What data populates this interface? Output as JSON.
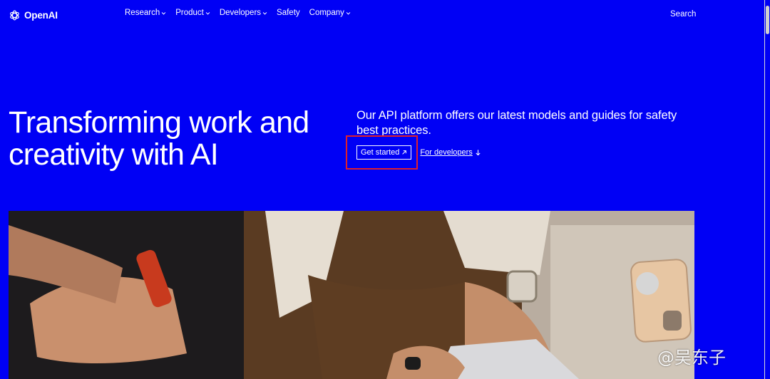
{
  "header": {
    "brand": "OpenAI",
    "nav": [
      {
        "label": "Research",
        "has_menu": true
      },
      {
        "label": "Product",
        "has_menu": true
      },
      {
        "label": "Developers",
        "has_menu": true
      },
      {
        "label": "Safety",
        "has_menu": false
      },
      {
        "label": "Company",
        "has_menu": true
      }
    ],
    "search_label": "Search"
  },
  "hero": {
    "headline_line1": "Transforming work and",
    "headline_line2": "creativity with AI",
    "subtext": "Our API platform offers our latest models and guides for safety best practices.",
    "primary_cta": "Get started",
    "primary_cta_icon": "arrow-up-right-icon",
    "secondary_cta": "For developers",
    "secondary_cta_icon": "arrow-down-icon"
  },
  "watermark": "@吴东子",
  "colors": {
    "background": "#0000f5",
    "text": "#ffffff",
    "highlight_box": "#e0202c"
  }
}
